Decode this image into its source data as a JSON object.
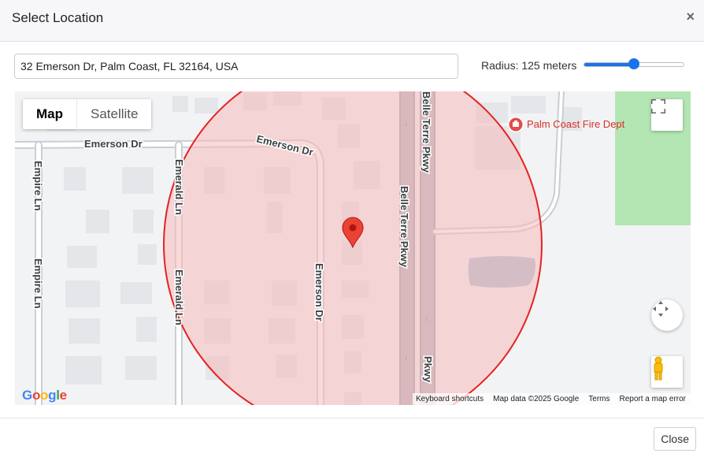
{
  "modal": {
    "title": "Select Location",
    "close_x": "×"
  },
  "address": {
    "value": "32 Emerson Dr, Palm Coast, FL 32164, USA"
  },
  "radius": {
    "label": "Radius: 125 meters",
    "value": 125,
    "slider_fraction": 0.5
  },
  "map": {
    "type_buttons": [
      "Map",
      "Satellite"
    ],
    "active_type": "Map",
    "roads": {
      "emerson_dr_west": "Emerson Dr",
      "emerson_dr_curve": "Emerson Dr",
      "emerson_dr_vertical": "Emerson Dr",
      "empire_ln_top": "Empire Ln",
      "empire_ln_bottom": "Empire Ln",
      "emerald_ln_top": "Emerald Ln",
      "emerald_ln_bottom": "Emerald Ln",
      "belle_terre_top": "Belle Terre Pkwy",
      "belle_terre_mid": "Belle Terre Pkwy",
      "belle_terre_bottom": "Pkwy"
    },
    "poi": "Palm Coast Fire Dept",
    "google_logo": [
      "G",
      "o",
      "o",
      "g",
      "l",
      "e"
    ],
    "attribution": {
      "shortcuts": "Keyboard shortcuts",
      "data": "Map data ©2025 Google",
      "terms": "Terms",
      "report": "Report a map error"
    },
    "colors": {
      "circle_fill": "#f7b9b9",
      "circle_stroke": "#e52222",
      "marker": "#ea4335",
      "water": "#aac1d6",
      "park": "#b4e6b4"
    },
    "icons": {
      "fullscreen": "fullscreen-icon",
      "camera": "camera-control-icon",
      "pegman": "pegman-icon",
      "marker": "map-pin-icon",
      "fire_station": "fire-station-icon"
    }
  },
  "footer": {
    "close_label": "Close"
  }
}
